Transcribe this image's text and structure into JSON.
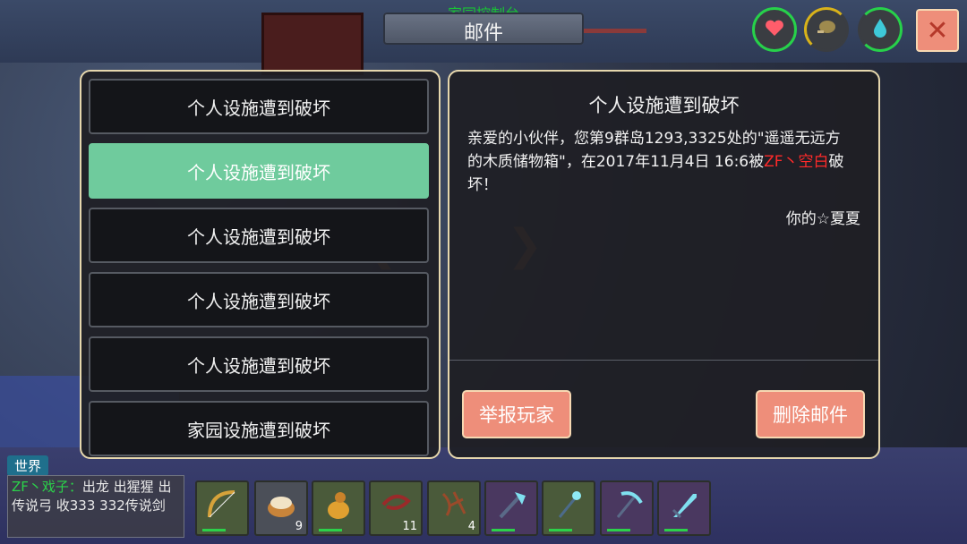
{
  "title": "邮件",
  "subtitle": "家园控制台",
  "stats": [
    {
      "name": "health",
      "icon": "heart-icon"
    },
    {
      "name": "food",
      "icon": "drumstick-icon"
    },
    {
      "name": "water",
      "icon": "droplet-icon"
    }
  ],
  "close_label": "✕",
  "mail_list": [
    "个人设施遭到破坏",
    "个人设施遭到破坏",
    "个人设施遭到破坏",
    "个人设施遭到破坏",
    "个人设施遭到破坏",
    "家园设施遭到破坏"
  ],
  "selected_index": 1,
  "detail": {
    "title": "个人设施遭到破坏",
    "body_part1": "亲爱的小伙伴，您第9群岛1293,3325处的\"遥遥无远方的木质储物箱\"，在2017年11月4日 16:6被",
    "body_red": "ZF丶空白",
    "body_part2": "破坏！",
    "signature": "你的☆夏夏",
    "report_button": "举报玩家",
    "delete_button": "删除邮件"
  },
  "chat": {
    "channel": "世界",
    "sender": "ZF丶戏子：",
    "message": "出龙 出猩猩 出传说弓 收333 332传说剑"
  },
  "hotbar": [
    {
      "icon": "bow-icon",
      "count": "",
      "durability": true,
      "color": "#3d4f37"
    },
    {
      "icon": "dumpling-basket-icon",
      "count": "9",
      "durability": false,
      "color": "#4b4f58"
    },
    {
      "icon": "gourd-icon",
      "count": "",
      "durability": true,
      "color": "#3d4f37"
    },
    {
      "icon": "whip-icon",
      "count": "11",
      "durability": false,
      "color": "#3d4f37"
    },
    {
      "icon": "vine-icon",
      "count": "4",
      "durability": false,
      "color": "#3d4f37"
    },
    {
      "icon": "crystal-axe-icon",
      "count": "",
      "durability": true,
      "color": "#4a3860"
    },
    {
      "icon": "crystal-staff-icon",
      "count": "",
      "durability": true,
      "color": "#3d4f37"
    },
    {
      "icon": "pickaxe-icon",
      "count": "",
      "durability": true,
      "color": "#4a3860"
    },
    {
      "icon": "crystal-sword-icon",
      "count": "",
      "durability": true,
      "color": "#4a3860"
    }
  ]
}
